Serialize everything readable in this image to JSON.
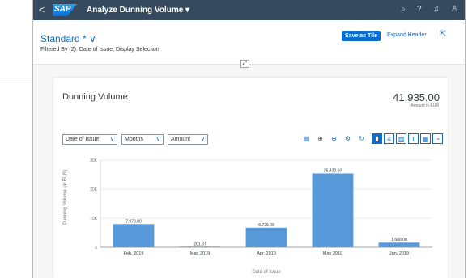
{
  "shell": {
    "back_glyph": "<",
    "logo": "SAP",
    "title": "Analyze Dunning Volume ▾",
    "icons": [
      "search-icon",
      "help-icon",
      "notifications-icon",
      "user-icon"
    ]
  },
  "header": {
    "variant": "Standard * ∨",
    "filtered_by": "Filtered By (2): Date of Issue, Display Selection",
    "save_as_tile": "Save as Tile",
    "expand_header": "Expand Header"
  },
  "card": {
    "title": "Dunning Volume",
    "kpi_value": "41,935.00",
    "kpi_unit": "Amount in EUR"
  },
  "toolbar": {
    "dimension_select": "Date of Issue",
    "period_select": "Months",
    "measure_select": "Amount"
  },
  "colors": {
    "shell": "#354a5f",
    "accent": "#0a6ed1",
    "bar": "#5899da"
  },
  "chart_data": {
    "type": "bar",
    "xlabel": "Date of Issue",
    "ylabel": "Dunning Volume (in EUR)",
    "ylim": [
      0,
      30000
    ],
    "yticks": [
      "30K",
      "20K",
      "10K",
      "0"
    ],
    "categories": [
      "Feb. 2019",
      "Mar. 2019",
      "Apr. 2019",
      "May 2019",
      "Jun. 2019"
    ],
    "values": [
      7978.0,
      201.37,
      6725.09,
      25430.6,
      1600.0
    ],
    "data_labels": [
      "7,978.00",
      "201.37",
      "6,725.09",
      "25,430.60",
      "1,600.00"
    ],
    "grid": true,
    "legend": "none"
  }
}
